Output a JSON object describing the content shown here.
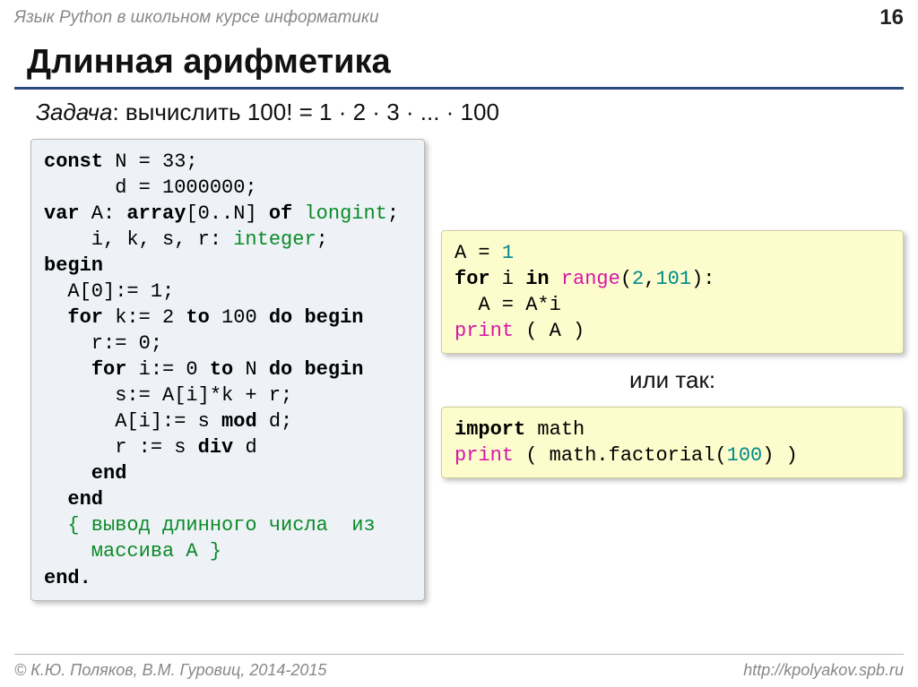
{
  "header": {
    "subject": "Язык Python в школьном курсе информатики",
    "page_number": "16"
  },
  "title": "Длинная арифметика",
  "task": {
    "label": "Задача",
    "text": ": вычислить 100! = 1 · 2 · 3  · ... · 100"
  },
  "pascal_code": {
    "l1a": "const",
    "l1b": " N = 33;",
    "l2": "      d = 1000000;",
    "l3a": "var",
    "l3b": " A: ",
    "l3c": "array",
    "l3d": "[0..N] ",
    "l3e": "of",
    "l3f": " longint",
    "l3g": ";",
    "l4a": "    i, k, s, r: ",
    "l4b": "integer",
    "l4c": ";",
    "l5": "begin",
    "l6": "  A[0]:= 1;",
    "l7a": "  ",
    "l7b": "for",
    "l7c": " k:= 2 ",
    "l7d": "to",
    "l7e": " 100 ",
    "l7f": "do begin",
    "l8": "    r:= 0;",
    "l9a": "    ",
    "l9b": "for",
    "l9c": " i:= 0 ",
    "l9d": "to",
    "l9e": " N ",
    "l9f": "do begin",
    "l10": "      s:= A[i]*k + r;",
    "l11a": "      A[i]:= s ",
    "l11b": "mod",
    "l11c": " d;",
    "l12a": "      r := s ",
    "l12b": "div",
    "l12c": " d",
    "l13": "    end",
    "l14": "  end",
    "l15a": "  { вывод длинного числа  из",
    "l15b": "    массива A }",
    "l16": "end."
  },
  "python_code1": {
    "l1a": "A = ",
    "l1b": "1",
    "l2a": "for",
    "l2b": " i ",
    "l2c": "in",
    "l2d": " ",
    "l2e": "range",
    "l2f": "(",
    "l2g": "2",
    "l2h": ",",
    "l2i": "101",
    "l2j": "):",
    "l3": "  A = A*i",
    "l4a": "print",
    "l4b": " ( A )"
  },
  "or_label": "или так:",
  "python_code2": {
    "l1a": "import",
    "l1b": " math",
    "l2a": "print",
    "l2b": " ( math.factorial(",
    "l2c": "100",
    "l2d": ") )"
  },
  "footer": {
    "left": "© К.Ю. Поляков, В.М. Гуровиц, 2014-2015",
    "right": "http://kpolyakov.spb.ru"
  }
}
